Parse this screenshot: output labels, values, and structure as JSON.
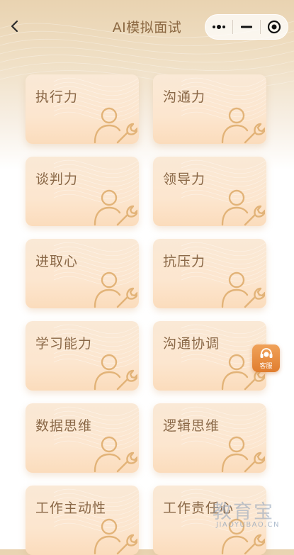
{
  "navbar": {
    "title": "AI模拟面试"
  },
  "cards": [
    {
      "label": "执行力"
    },
    {
      "label": "沟通力"
    },
    {
      "label": "谈判力"
    },
    {
      "label": "领导力"
    },
    {
      "label": "进取心"
    },
    {
      "label": "抗压力"
    },
    {
      "label": "学习能力"
    },
    {
      "label": "沟通协调"
    },
    {
      "label": "数据思维"
    },
    {
      "label": "逻辑思维"
    },
    {
      "label": "工作主动性"
    },
    {
      "label": "工作责任心"
    }
  ],
  "customer_service": {
    "label": "客服"
  },
  "watermark": {
    "brand": "教育宝",
    "url": "JIAOYUBAO.CN"
  },
  "colors": {
    "title_text": "#8d6a44",
    "card_text": "#8a6847",
    "card_icon": "#e2b378",
    "cs_button": "#e8893a"
  }
}
